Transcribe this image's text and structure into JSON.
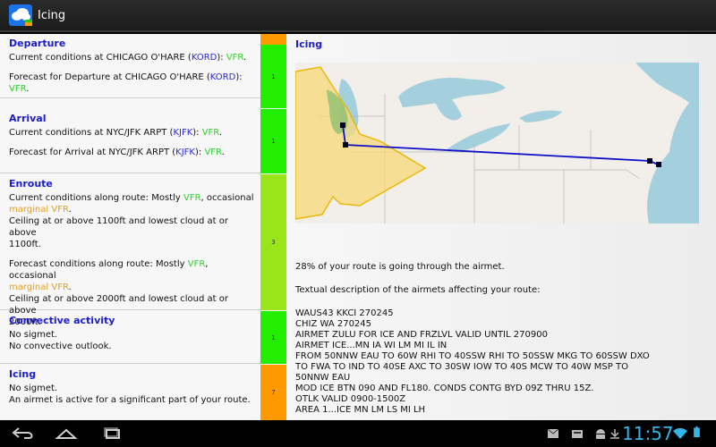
{
  "app": {
    "title": "Icing"
  },
  "left": {
    "departure": {
      "title": "Departure",
      "l1_pre": "Current conditions at CHICAGO O'HARE (",
      "l1_ap": "KORD",
      "l1_mid": "): ",
      "l1_flight": "VFR",
      "l1_end": ".",
      "l2_pre": "Forecast for Departure at CHICAGO O'HARE (",
      "l2_ap": "KORD",
      "l2_mid": "): ",
      "l2_flight": "VFR",
      "l2_end": ".",
      "rating": "1"
    },
    "arrival": {
      "title": "Arrival",
      "l1_pre": "Current conditions at NYC/JFK ARPT (",
      "l1_ap": "KJFK",
      "l1_mid": "): ",
      "l1_flight": "VFR",
      "l1_end": ".",
      "l2_pre": "Forecast for Arrival at NYC/JFK ARPT (",
      "l2_ap": "KJFK",
      "l2_mid": "): ",
      "l2_flight": "VFR",
      "l2_end": ".",
      "rating": "1"
    },
    "enroute": {
      "title": "Enroute",
      "c_pre": "Current conditions along route: Mostly ",
      "c_vfr": "VFR",
      "c_mid": ", occasional",
      "c_mvfr": "marginal VFR",
      "c_end": ".",
      "c_ceiling1": "Ceiling at or above 1100ft and lowest cloud at or above",
      "c_ceiling2": "1100ft.",
      "f_pre": "Forecast conditions along route: Mostly ",
      "f_vfr": "VFR",
      "f_mid": ", occasional",
      "f_mvfr": "marginal VFR",
      "f_end": ".",
      "f_ceiling1": "Ceiling at or above 2000ft and lowest cloud at or above",
      "f_ceiling2": "2000ft.",
      "rating": "3"
    },
    "convective": {
      "title": "Convective activity",
      "l1": "No sigmet.",
      "l2": "No convective outlook.",
      "rating": "1"
    },
    "icing": {
      "title": "Icing",
      "l1": "No sigmet.",
      "l2": "An airmet is active for a significant part of your route.",
      "rating": "7"
    }
  },
  "right": {
    "title": "Icing",
    "percent_text": "28% of your route is going through the airmet.",
    "desc_label": "Textual description of the airmets affecting your route:",
    "airmet_lines": [
      "WAUS43 KKCI 270245",
      "CHIZ WA 270245",
      "AIRMET ZULU FOR ICE AND FRZLVL VALID UNTIL 270900",
      "AIRMET ICE...MN IA WI LM MI IL IN",
      "FROM 50NNW EAU TO 60W RHI TO 40SSW RHI TO 50SSW MKG TO 60SSW DXO",
      "TO FWA TO IND TO 40SE AXC TO 30SW IOW TO 40S MCW TO 40W MSP TO",
      "50NNW EAU",
      "MOD ICE BTN 090 AND FL180. CONDS CONTG BYD 09Z THRU 15Z.",
      "OTLK VALID 0900-1500Z",
      "AREA 1...ICE MN LM LS MI LH"
    ]
  },
  "status": {
    "time": "11:57"
  },
  "colors": {
    "green": "#22ee00",
    "lime": "#99e51a",
    "orange": "#ff9900",
    "link": "#1c1ccc"
  }
}
